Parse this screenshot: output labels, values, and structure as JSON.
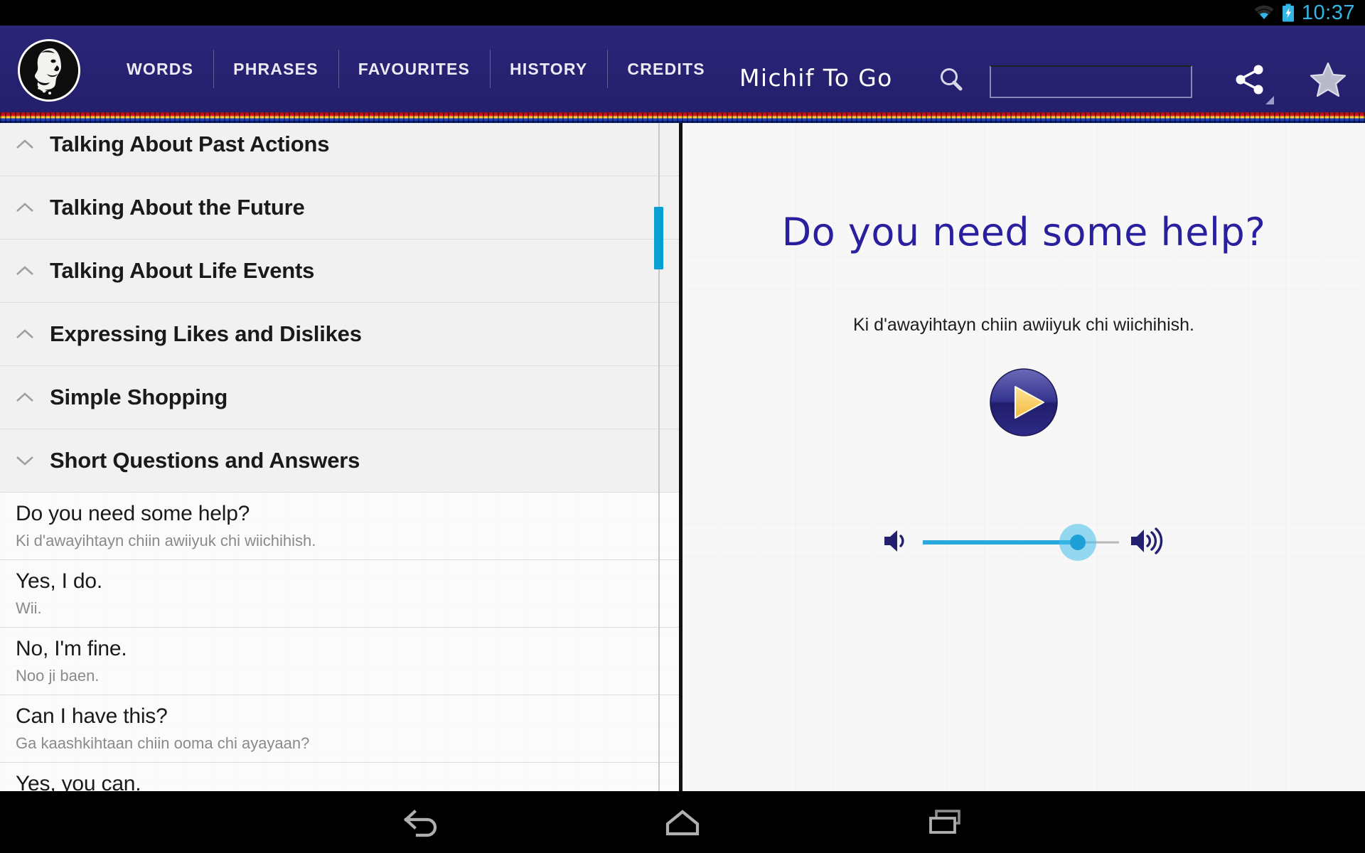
{
  "status_bar": {
    "clock": "10:37",
    "wifi_icon": "wifi-icon",
    "battery_icon": "battery-charging-icon",
    "accent_color": "#33B5E5"
  },
  "header": {
    "app_title": "Michif To Go",
    "logo_icon": "app-logo-elder-portrait",
    "background_color": "#272273",
    "active_tab_indicator_color": "#33B5E5",
    "tabs": [
      {
        "label": "WORDS",
        "active": false
      },
      {
        "label": "PHRASES",
        "active": true
      },
      {
        "label": "FAVOURITES",
        "active": false
      },
      {
        "label": "HISTORY",
        "active": false
      },
      {
        "label": "CREDITS",
        "active": false
      }
    ],
    "search": {
      "icon": "search-icon",
      "value": "",
      "placeholder": ""
    },
    "actions": [
      {
        "name": "share-icon",
        "label": "Share"
      },
      {
        "name": "star-icon",
        "label": "Favourite"
      }
    ]
  },
  "sash": {
    "colors": [
      "#b3121a",
      "#e01f26",
      "#f2cf3a",
      "#1c3fbf",
      "#0d1d6e"
    ]
  },
  "list_pane": {
    "categories": [
      {
        "label": "Talking About Past Actions",
        "expanded": false,
        "chevron": "chevron-up-icon"
      },
      {
        "label": "Talking About the Future",
        "expanded": false,
        "chevron": "chevron-up-icon"
      },
      {
        "label": "Talking About Life Events",
        "expanded": false,
        "chevron": "chevron-up-icon"
      },
      {
        "label": "Expressing Likes and Dislikes",
        "expanded": false,
        "chevron": "chevron-up-icon"
      },
      {
        "label": "Simple Shopping",
        "expanded": false,
        "chevron": "chevron-up-icon"
      },
      {
        "label": "Short Questions and Answers",
        "expanded": true,
        "chevron": "chevron-down-icon"
      }
    ],
    "phrases": [
      {
        "english": "Do you need some help?",
        "michif": "Ki d'awayihtayn chiin awiiyuk chi wiichihish.",
        "selected": true
      },
      {
        "english": "Yes, I do.",
        "michif": "Wii.",
        "selected": false
      },
      {
        "english": "No, I'm fine.",
        "michif": "Noo ji baen.",
        "selected": false
      },
      {
        "english": "Can I have this?",
        "michif": "Ga kaashkihtaan chiin ooma chi ayayaan?",
        "selected": false
      },
      {
        "english": "Yes, you can.",
        "michif": "",
        "selected": false
      }
    ],
    "scrollbar_color": "#0a9fd1"
  },
  "detail_pane": {
    "headline": "Do you need some help?",
    "headline_color": "#2a1f9e",
    "michif": "Ki d'awayihtayn chiin awiiyuk chi wiichihish.",
    "play_button": {
      "name": "play-button",
      "label": "Play"
    },
    "volume": {
      "low_icon": "volume-low-icon",
      "high_icon": "volume-high-icon",
      "level_percent": 79,
      "accent_color": "#2aa8e0"
    }
  },
  "nav_bar": {
    "buttons": [
      {
        "name": "back-button",
        "icon": "back-arrow-icon"
      },
      {
        "name": "home-button",
        "icon": "home-icon"
      },
      {
        "name": "recents-button",
        "icon": "recents-icon"
      }
    ]
  }
}
